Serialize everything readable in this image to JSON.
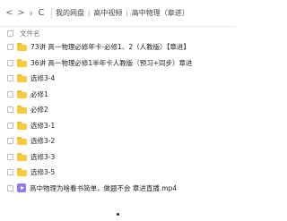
{
  "toolbar": {
    "back_icon": "chevron-left-icon",
    "forward_icon": "chevron-right-icon",
    "history_icon": "chevron-down-icon",
    "refresh_icon": "refresh-icon",
    "breadcrumbs": [
      "我的网盘",
      "高中视频",
      "高中物理（章进）"
    ],
    "back_glyph": "<",
    "forward_glyph": ">",
    "history_glyph": "∨",
    "refresh_glyph": "C"
  },
  "header": {
    "column_name": "文件名"
  },
  "files": [
    {
      "type": "folder",
      "name": "73讲 高一物理必修年卡-必修1、2（人教版）【章进】"
    },
    {
      "type": "folder",
      "name": "36讲 高一物理必修1半年卡人教版（预习+同步）章进"
    },
    {
      "type": "folder",
      "name": "选修3-4"
    },
    {
      "type": "folder",
      "name": "必修1"
    },
    {
      "type": "folder",
      "name": "必修2"
    },
    {
      "type": "folder",
      "name": "选修3-1"
    },
    {
      "type": "folder",
      "name": "选修3-2"
    },
    {
      "type": "folder",
      "name": "选修3-3"
    },
    {
      "type": "folder",
      "name": "选修3-5"
    },
    {
      "type": "video",
      "name": "高中物理为啥看书简单，做题不会 章进直播.mp4"
    }
  ],
  "colors": {
    "folder": "#fcc93d",
    "video": "#8b7cf2"
  }
}
